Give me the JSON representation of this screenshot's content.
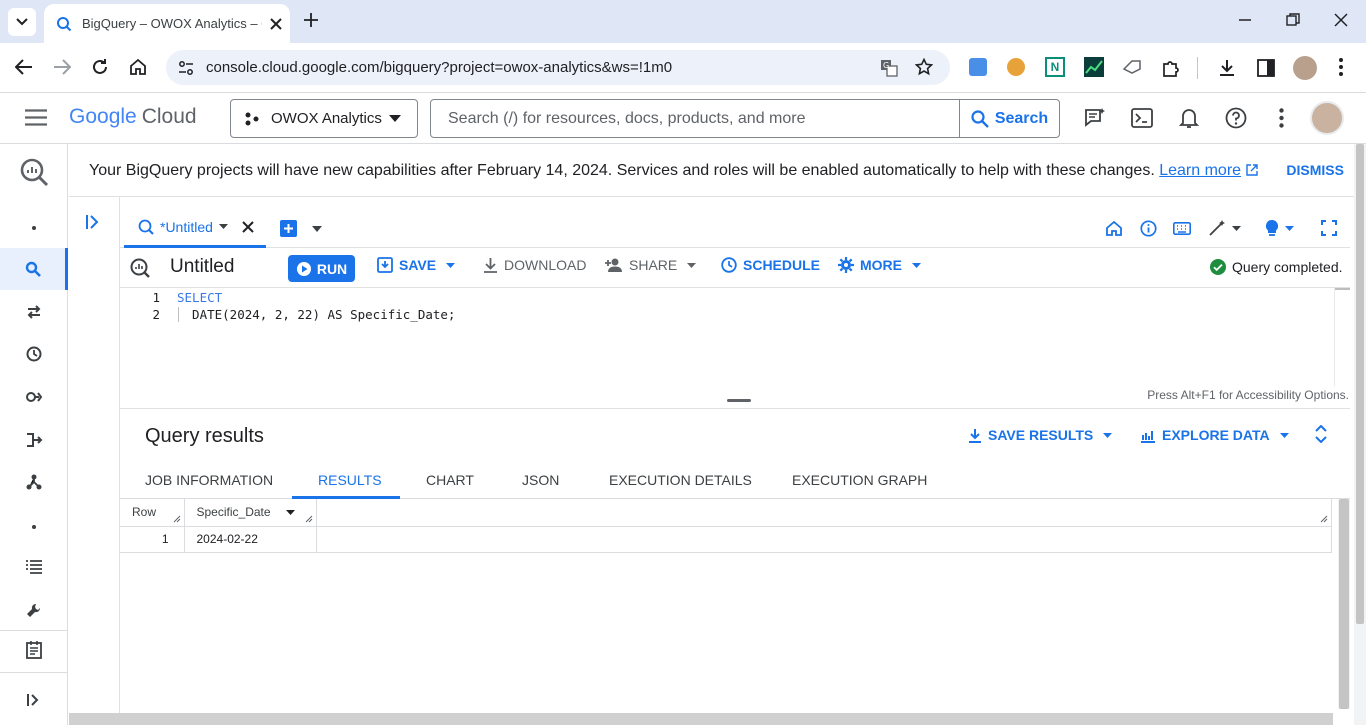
{
  "browser": {
    "tab_title": "BigQuery – OWOX Analytics – G",
    "url": "console.cloud.google.com/bigquery?project=owox-analytics&ws=!1m0"
  },
  "gcp": {
    "logo_google": "Google",
    "logo_cloud": "Cloud",
    "project": "OWOX Analytics",
    "search_placeholder": "Search (/) for resources, docs, products, and more",
    "search_button": "Search"
  },
  "banner": {
    "message": "Your BigQuery projects will have new capabilities after February 14, 2024. Services and roles will be enabled automatically to help with these changes.",
    "learn_more": "Learn more",
    "dismiss": "DISMISS"
  },
  "editor_tab": {
    "label": "*Untitled"
  },
  "toolbar": {
    "title": "Untitled",
    "run": "RUN",
    "save": "SAVE",
    "download": "DOWNLOAD",
    "share": "SHARE",
    "schedule": "SCHEDULE",
    "more": "MORE",
    "status": "Query completed."
  },
  "code": {
    "lines": [
      {
        "num": "1",
        "text": "SELECT"
      },
      {
        "num": "2",
        "text": "  DATE(2024, 2, 22) AS Specific_Date;"
      }
    ],
    "accessibility_hint": "Press Alt+F1 for Accessibility Options."
  },
  "results": {
    "title": "Query results",
    "save_results": "SAVE RESULTS",
    "explore_data": "EXPLORE DATA",
    "tabs": [
      "JOB INFORMATION",
      "RESULTS",
      "CHART",
      "JSON",
      "EXECUTION DETAILS",
      "EXECUTION GRAPH"
    ],
    "active_tab": "RESULTS",
    "columns": [
      "Row",
      "Specific_Date"
    ],
    "rows": [
      {
        "row": "1",
        "Specific_Date": "2024-02-22"
      }
    ]
  }
}
